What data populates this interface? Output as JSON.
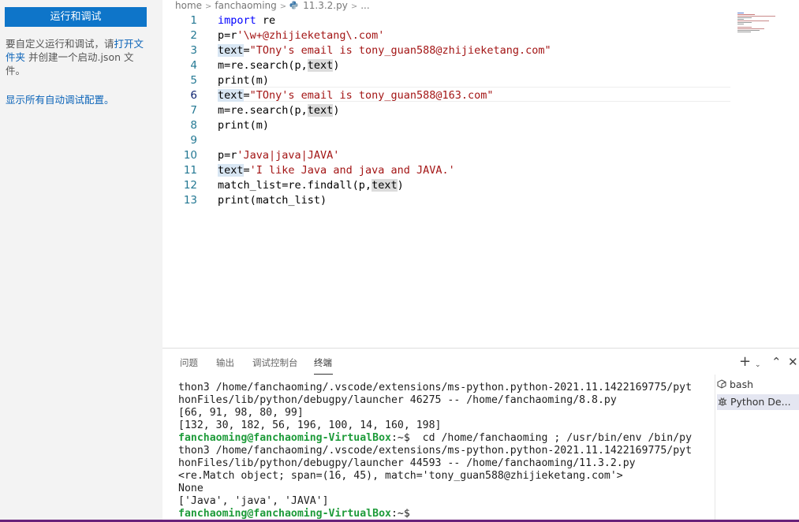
{
  "sidebar": {
    "run_button": "运行和调试",
    "desc_before": "要自定义运行和调试，请",
    "desc_link": "打开文件夹",
    "desc_after": " 并创建一个启动.json 文件。",
    "show_all": "显示所有自动调试配置。"
  },
  "breadcrumb": {
    "home": "home",
    "user": "fanchaoming",
    "file": "11.3.2.py",
    "more": "..."
  },
  "editor": {
    "current_line": 6,
    "lines": [
      "1",
      "2",
      "3",
      "4",
      "5",
      "6",
      "7",
      "8",
      "9",
      "10",
      "11",
      "12",
      "13"
    ],
    "code": {
      "l1_kw": "import",
      "l1_rest": " re",
      "l2_a": "p=r",
      "l2_str": "'\\w+@zhijieketang\\.com'",
      "l3_var": "text",
      "l3_eq": "=",
      "l3_str": "\"TOny's email is tony_guan588@zhijieketang.com\"",
      "l4_a": "m=re.search(p,",
      "l4_var": "text",
      "l4_b": ")",
      "l5": "print(m)",
      "l6_var": "text",
      "l6_eq": "=",
      "l6_str": "\"TOny's email is tony_guan588@163.com\"",
      "l7_a": "m=re.search(p,",
      "l7_var": "text",
      "l7_b": ")",
      "l8": "print(m)",
      "l10_a": "p=r",
      "l10_str": "'Java|java|JAVA'",
      "l11_var": "text",
      "l11_eq": "=",
      "l11_str": "'I like Java and java and JAVA.'",
      "l12_a": "match_list=re.findall(p,",
      "l12_var": "text",
      "l12_b": ")",
      "l13": "print(match_list)"
    }
  },
  "panel": {
    "tabs": [
      "问题",
      "输出",
      "调试控制台",
      "终端"
    ],
    "active_tab": "终端",
    "terminal": {
      "l1": "thon3 /home/fanchaoming/.vscode/extensions/ms-python.python-2021.11.1422169775/pyt",
      "l2": "honFiles/lib/python/debugpy/launcher 46275 -- /home/fanchaoming/8.8.py",
      "l3": "[66, 91, 98, 80, 99]",
      "l4": "[132, 30, 182, 56, 196, 100, 14, 160, 198]",
      "prompt": "fanchaoming@fanchaoming-VirtualBox",
      "prompt_suffix": ":~$",
      "l5_cmd": "  cd /home/fanchaoming ; /usr/bin/env /bin/py",
      "l6": "thon3 /home/fanchaoming/.vscode/extensions/ms-python.python-2021.11.1422169775/pyt",
      "l7": "honFiles/lib/python/debugpy/launcher 44593 -- /home/fanchaoming/11.3.2.py",
      "l8": "<re.Match object; span=(16, 45), match='tony_guan588@zhijieketang.com'>",
      "l9": "None",
      "l10": "['Java', 'java', 'JAVA']",
      "l11_cmd": " "
    },
    "term_list": [
      {
        "icon": "bash-icon",
        "label": "bash"
      },
      {
        "icon": "debug-icon",
        "label": "Python De..."
      }
    ]
  }
}
